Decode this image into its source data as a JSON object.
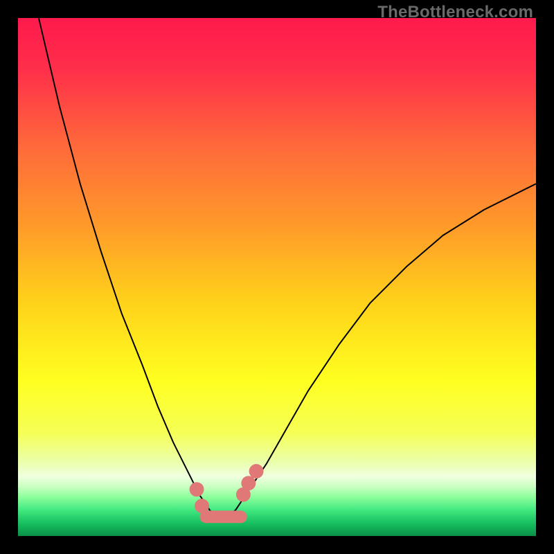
{
  "watermark": "TheBottleneck.com",
  "chart_data": {
    "type": "line",
    "title": "",
    "xlabel": "",
    "ylabel": "",
    "xlim": [
      0,
      100
    ],
    "ylim": [
      0,
      100
    ],
    "grid": false,
    "legend": false,
    "series": [
      {
        "name": "bottleneck-curve",
        "color": "#000000",
        "x": [
          4,
          8,
          12,
          16,
          20,
          24,
          27,
          30,
          33,
          35,
          37,
          38.5,
          40,
          42,
          44,
          48,
          52,
          56,
          62,
          68,
          75,
          82,
          90,
          100
        ],
        "y": [
          100,
          83,
          68,
          55,
          43,
          33,
          25,
          18,
          12,
          8,
          5,
          3.5,
          3.5,
          5,
          8,
          14,
          21,
          28,
          37,
          45,
          52,
          58,
          63,
          68
        ]
      }
    ],
    "markers": [
      {
        "name": "dot",
        "x": 34.5,
        "y": 9.0,
        "r": 1.4,
        "color": "#e07878"
      },
      {
        "name": "dot",
        "x": 35.5,
        "y": 5.8,
        "r": 1.4,
        "color": "#e07878"
      },
      {
        "name": "dot",
        "x": 43.5,
        "y": 8.0,
        "r": 1.4,
        "color": "#e07878"
      },
      {
        "name": "dot",
        "x": 44.5,
        "y": 10.2,
        "r": 1.4,
        "color": "#e07878"
      },
      {
        "name": "dot",
        "x": 46.0,
        "y": 12.5,
        "r": 1.4,
        "color": "#e07878"
      }
    ],
    "bottom_band": {
      "name": "bottom-marker-band",
      "color": "#e07878",
      "x_start": 36.3,
      "x_end": 43.0,
      "y": 3.7,
      "thickness": 2.4,
      "end_radius": 1.2
    },
    "background_gradient": {
      "stops": [
        {
          "offset": 0.0,
          "color": "#ff1a4d"
        },
        {
          "offset": 0.1,
          "color": "#ff2f4a"
        },
        {
          "offset": 0.25,
          "color": "#ff6a3a"
        },
        {
          "offset": 0.4,
          "color": "#ff9a2a"
        },
        {
          "offset": 0.55,
          "color": "#ffd21a"
        },
        {
          "offset": 0.7,
          "color": "#ffff20"
        },
        {
          "offset": 0.8,
          "color": "#f6ff55"
        },
        {
          "offset": 0.86,
          "color": "#eaffb0"
        },
        {
          "offset": 0.885,
          "color": "#f0ffe0"
        },
        {
          "offset": 0.905,
          "color": "#c8ffc0"
        },
        {
          "offset": 0.925,
          "color": "#8cff9c"
        },
        {
          "offset": 0.95,
          "color": "#40e880"
        },
        {
          "offset": 0.975,
          "color": "#18c060"
        },
        {
          "offset": 1.0,
          "color": "#0a9048"
        }
      ]
    }
  }
}
